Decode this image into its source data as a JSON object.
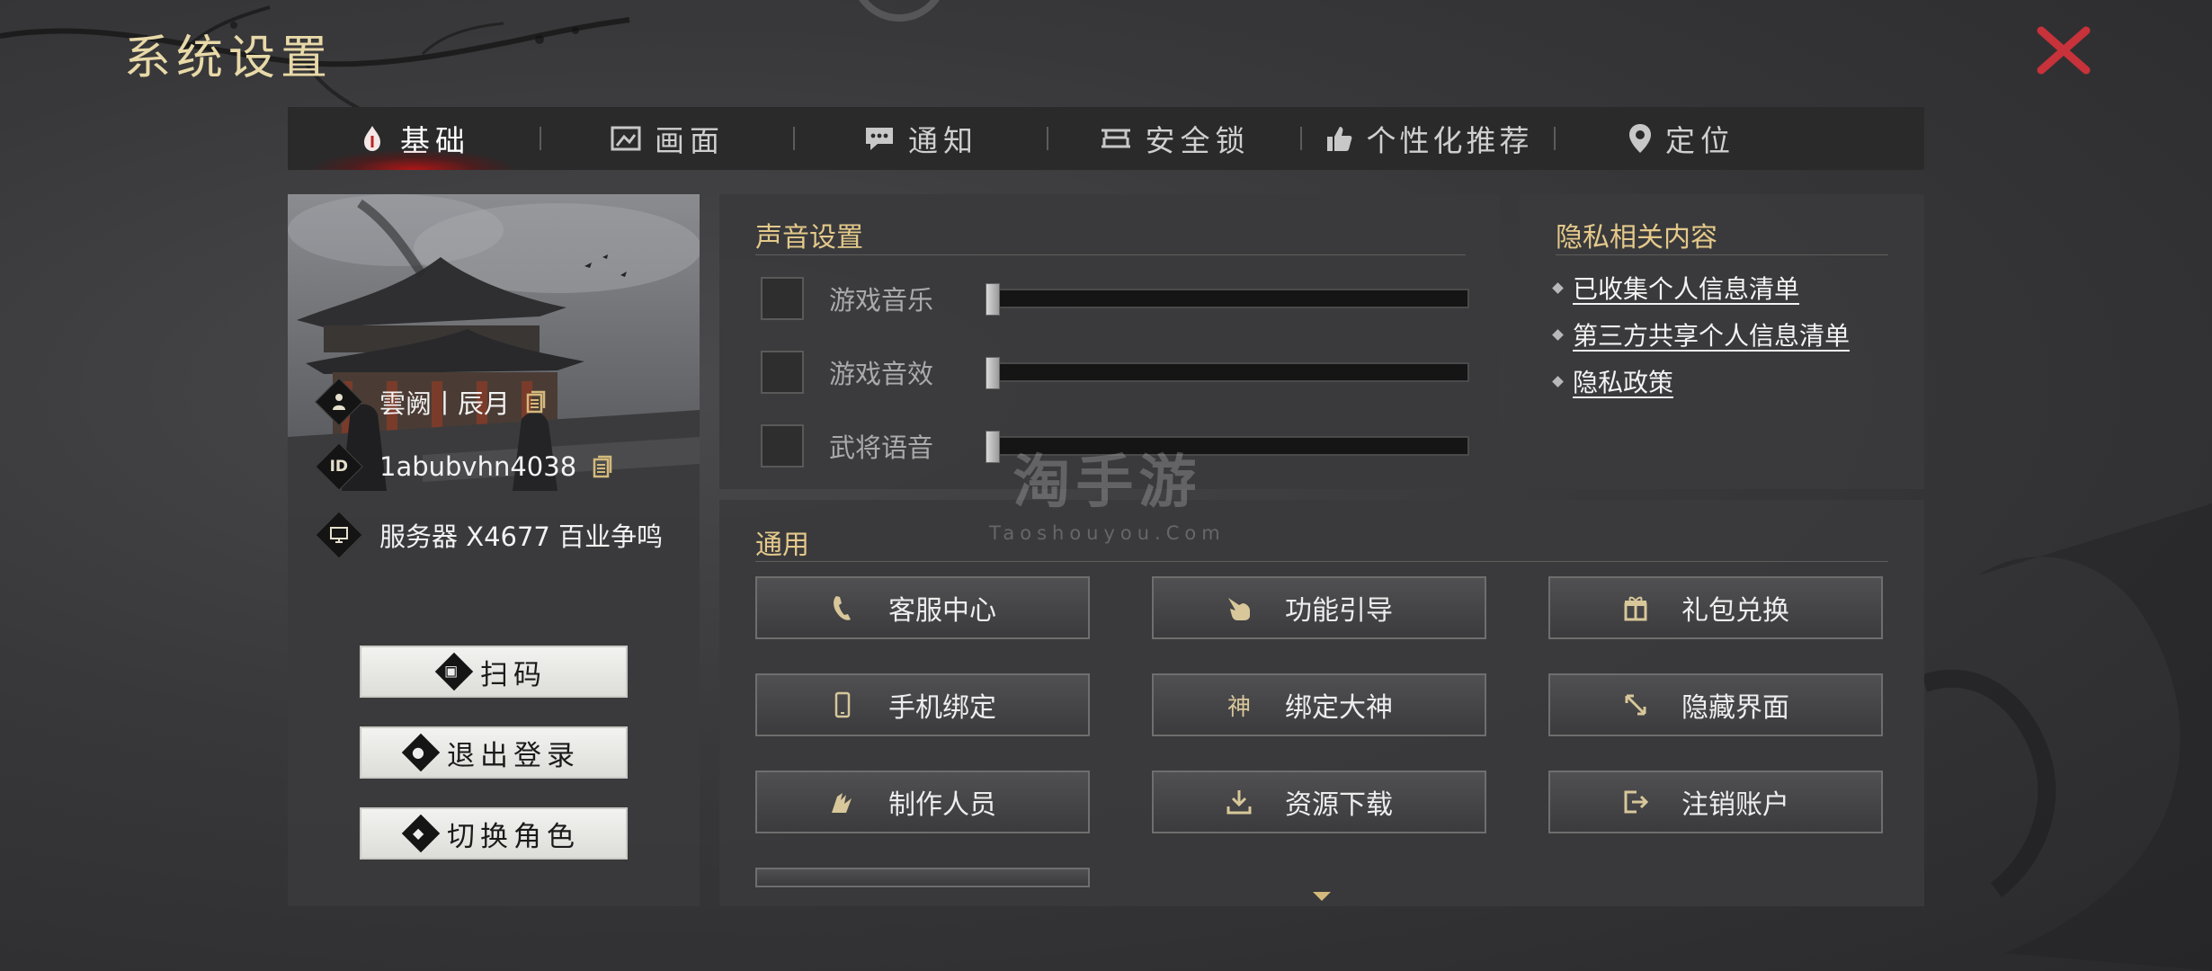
{
  "header": {
    "title": "系统设置",
    "close_icon": "close-icon"
  },
  "tabs": [
    {
      "label": "基础",
      "icon": "basic-icon",
      "active": true
    },
    {
      "label": "画面",
      "icon": "display-icon",
      "active": false
    },
    {
      "label": "通知",
      "icon": "notification-icon",
      "active": false
    },
    {
      "label": "安全锁",
      "icon": "security-lock-icon",
      "active": false
    },
    {
      "label": "个性化推荐",
      "icon": "thumbs-up-icon",
      "active": false
    },
    {
      "label": "定位",
      "icon": "location-pin-icon",
      "active": false
    }
  ],
  "profile": {
    "character_name": "雲阙丨辰月",
    "user_id": "1abubvhn4038",
    "server": "服务器 X4677 百业争鸣",
    "buttons": {
      "scan": "扫码",
      "logout": "退出登录",
      "switch_role": "切换角色"
    }
  },
  "sound": {
    "title": "声音设置",
    "items": [
      {
        "label": "游戏音乐",
        "checked": false,
        "level": 0
      },
      {
        "label": "游戏音效",
        "checked": false,
        "level": 0
      },
      {
        "label": "武将语音",
        "checked": false,
        "level": 0
      }
    ]
  },
  "privacy": {
    "title": "隐私相关内容",
    "links": [
      "已收集个人信息清单",
      "第三方共享个人信息清单",
      "隐私政策"
    ]
  },
  "general": {
    "title": "通用",
    "buttons": [
      {
        "label": "客服中心",
        "icon": "phone-icon"
      },
      {
        "label": "功能引导",
        "icon": "pointing-hand-icon"
      },
      {
        "label": "礼包兑换",
        "icon": "gift-icon"
      },
      {
        "label": "手机绑定",
        "icon": "mobile-icon"
      },
      {
        "label": "绑定大神",
        "icon": "shen-icon",
        "icon_glyph": "神"
      },
      {
        "label": "隐藏界面",
        "icon": "resize-arrow-icon"
      },
      {
        "label": "制作人员",
        "icon": "team-icon"
      },
      {
        "label": "资源下载",
        "icon": "download-icon"
      },
      {
        "label": "注销账户",
        "icon": "logout-icon"
      }
    ]
  },
  "watermark": {
    "main": "淘手游",
    "sub": "Taoshouyou.Com"
  },
  "colors": {
    "accent_gold": "#e4c98a",
    "tab_active_red": "#be1414",
    "close_red": "#c8323a"
  }
}
